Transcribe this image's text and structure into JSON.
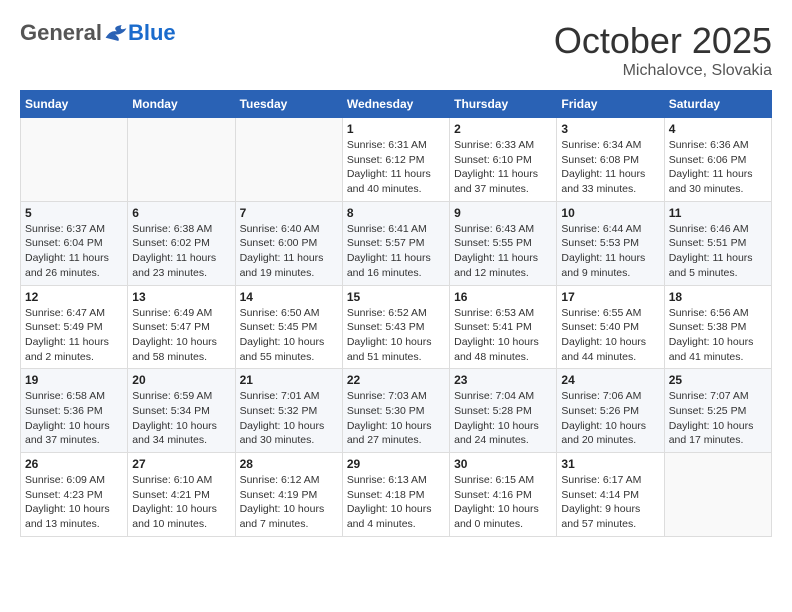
{
  "header": {
    "logo_general": "General",
    "logo_blue": "Blue",
    "month_title": "October 2025",
    "location": "Michalovce, Slovakia"
  },
  "calendar": {
    "days_of_week": [
      "Sunday",
      "Monday",
      "Tuesday",
      "Wednesday",
      "Thursday",
      "Friday",
      "Saturday"
    ],
    "weeks": [
      [
        {
          "day": "",
          "info": ""
        },
        {
          "day": "",
          "info": ""
        },
        {
          "day": "",
          "info": ""
        },
        {
          "day": "1",
          "info": "Sunrise: 6:31 AM\nSunset: 6:12 PM\nDaylight: 11 hours and 40 minutes."
        },
        {
          "day": "2",
          "info": "Sunrise: 6:33 AM\nSunset: 6:10 PM\nDaylight: 11 hours and 37 minutes."
        },
        {
          "day": "3",
          "info": "Sunrise: 6:34 AM\nSunset: 6:08 PM\nDaylight: 11 hours and 33 minutes."
        },
        {
          "day": "4",
          "info": "Sunrise: 6:36 AM\nSunset: 6:06 PM\nDaylight: 11 hours and 30 minutes."
        }
      ],
      [
        {
          "day": "5",
          "info": "Sunrise: 6:37 AM\nSunset: 6:04 PM\nDaylight: 11 hours and 26 minutes."
        },
        {
          "day": "6",
          "info": "Sunrise: 6:38 AM\nSunset: 6:02 PM\nDaylight: 11 hours and 23 minutes."
        },
        {
          "day": "7",
          "info": "Sunrise: 6:40 AM\nSunset: 6:00 PM\nDaylight: 11 hours and 19 minutes."
        },
        {
          "day": "8",
          "info": "Sunrise: 6:41 AM\nSunset: 5:57 PM\nDaylight: 11 hours and 16 minutes."
        },
        {
          "day": "9",
          "info": "Sunrise: 6:43 AM\nSunset: 5:55 PM\nDaylight: 11 hours and 12 minutes."
        },
        {
          "day": "10",
          "info": "Sunrise: 6:44 AM\nSunset: 5:53 PM\nDaylight: 11 hours and 9 minutes."
        },
        {
          "day": "11",
          "info": "Sunrise: 6:46 AM\nSunset: 5:51 PM\nDaylight: 11 hours and 5 minutes."
        }
      ],
      [
        {
          "day": "12",
          "info": "Sunrise: 6:47 AM\nSunset: 5:49 PM\nDaylight: 11 hours and 2 minutes."
        },
        {
          "day": "13",
          "info": "Sunrise: 6:49 AM\nSunset: 5:47 PM\nDaylight: 10 hours and 58 minutes."
        },
        {
          "day": "14",
          "info": "Sunrise: 6:50 AM\nSunset: 5:45 PM\nDaylight: 10 hours and 55 minutes."
        },
        {
          "day": "15",
          "info": "Sunrise: 6:52 AM\nSunset: 5:43 PM\nDaylight: 10 hours and 51 minutes."
        },
        {
          "day": "16",
          "info": "Sunrise: 6:53 AM\nSunset: 5:41 PM\nDaylight: 10 hours and 48 minutes."
        },
        {
          "day": "17",
          "info": "Sunrise: 6:55 AM\nSunset: 5:40 PM\nDaylight: 10 hours and 44 minutes."
        },
        {
          "day": "18",
          "info": "Sunrise: 6:56 AM\nSunset: 5:38 PM\nDaylight: 10 hours and 41 minutes."
        }
      ],
      [
        {
          "day": "19",
          "info": "Sunrise: 6:58 AM\nSunset: 5:36 PM\nDaylight: 10 hours and 37 minutes."
        },
        {
          "day": "20",
          "info": "Sunrise: 6:59 AM\nSunset: 5:34 PM\nDaylight: 10 hours and 34 minutes."
        },
        {
          "day": "21",
          "info": "Sunrise: 7:01 AM\nSunset: 5:32 PM\nDaylight: 10 hours and 30 minutes."
        },
        {
          "day": "22",
          "info": "Sunrise: 7:03 AM\nSunset: 5:30 PM\nDaylight: 10 hours and 27 minutes."
        },
        {
          "day": "23",
          "info": "Sunrise: 7:04 AM\nSunset: 5:28 PM\nDaylight: 10 hours and 24 minutes."
        },
        {
          "day": "24",
          "info": "Sunrise: 7:06 AM\nSunset: 5:26 PM\nDaylight: 10 hours and 20 minutes."
        },
        {
          "day": "25",
          "info": "Sunrise: 7:07 AM\nSunset: 5:25 PM\nDaylight: 10 hours and 17 minutes."
        }
      ],
      [
        {
          "day": "26",
          "info": "Sunrise: 6:09 AM\nSunset: 4:23 PM\nDaylight: 10 hours and 13 minutes."
        },
        {
          "day": "27",
          "info": "Sunrise: 6:10 AM\nSunset: 4:21 PM\nDaylight: 10 hours and 10 minutes."
        },
        {
          "day": "28",
          "info": "Sunrise: 6:12 AM\nSunset: 4:19 PM\nDaylight: 10 hours and 7 minutes."
        },
        {
          "day": "29",
          "info": "Sunrise: 6:13 AM\nSunset: 4:18 PM\nDaylight: 10 hours and 4 minutes."
        },
        {
          "day": "30",
          "info": "Sunrise: 6:15 AM\nSunset: 4:16 PM\nDaylight: 10 hours and 0 minutes."
        },
        {
          "day": "31",
          "info": "Sunrise: 6:17 AM\nSunset: 4:14 PM\nDaylight: 9 hours and 57 minutes."
        },
        {
          "day": "",
          "info": ""
        }
      ]
    ]
  }
}
